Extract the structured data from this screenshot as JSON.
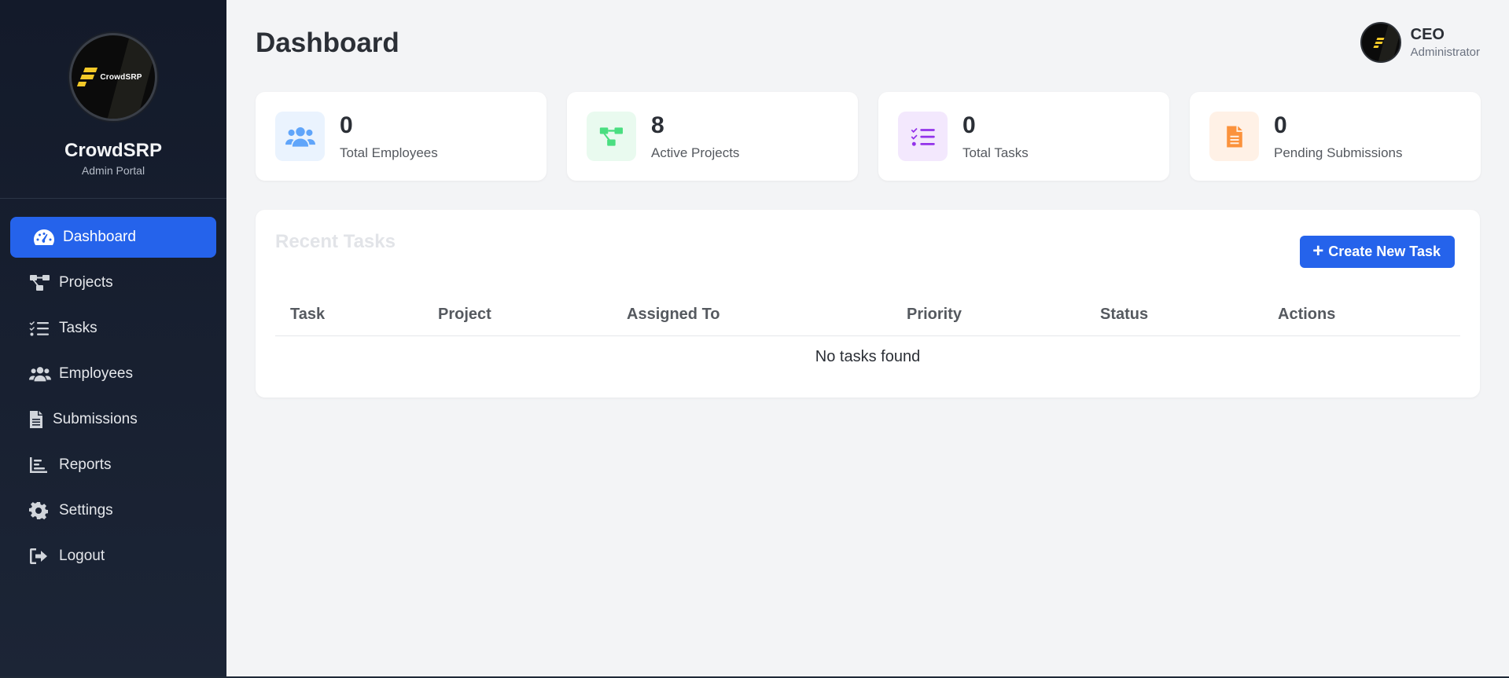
{
  "brand": {
    "logo_text": "CrowdSRP",
    "name": "CrowdSRP",
    "subtitle": "Admin Portal"
  },
  "nav": [
    {
      "label": "Dashboard",
      "icon": "gauge-icon",
      "active": true
    },
    {
      "label": "Projects",
      "icon": "project-diagram-icon",
      "active": false
    },
    {
      "label": "Tasks",
      "icon": "tasks-list-icon",
      "active": false
    },
    {
      "label": "Employees",
      "icon": "users-icon",
      "active": false
    },
    {
      "label": "Submissions",
      "icon": "file-icon",
      "active": false
    },
    {
      "label": "Reports",
      "icon": "chart-bar-icon",
      "active": false
    },
    {
      "label": "Settings",
      "icon": "gear-icon",
      "active": false
    },
    {
      "label": "Logout",
      "icon": "logout-icon",
      "active": false
    }
  ],
  "header": {
    "title": "Dashboard",
    "user": {
      "name": "CEO",
      "role": "Administrator"
    }
  },
  "stats": [
    {
      "value": "0",
      "label": "Total Employees",
      "icon": "users-icon",
      "color": "#60a5fa",
      "bg": "#eaf3fe"
    },
    {
      "value": "8",
      "label": "Active Projects",
      "icon": "project-diagram-icon",
      "color": "#4ade80",
      "bg": "#e9faef"
    },
    {
      "value": "0",
      "label": "Total Tasks",
      "icon": "tasks-list-icon",
      "color": "#9333ea",
      "bg": "#f3e8fd"
    },
    {
      "value": "0",
      "label": "Pending Submissions",
      "icon": "file-icon",
      "color": "#fb923c",
      "bg": "#fff1e6"
    }
  ],
  "recent_tasks": {
    "title": "Recent Tasks",
    "create_button": "Create New Task",
    "columns": [
      "Task",
      "Project",
      "Assigned To",
      "Priority",
      "Status",
      "Actions"
    ],
    "empty_message": "No tasks found"
  },
  "colors": {
    "accent": "#2563eb",
    "sidebar": "#161e2e"
  }
}
